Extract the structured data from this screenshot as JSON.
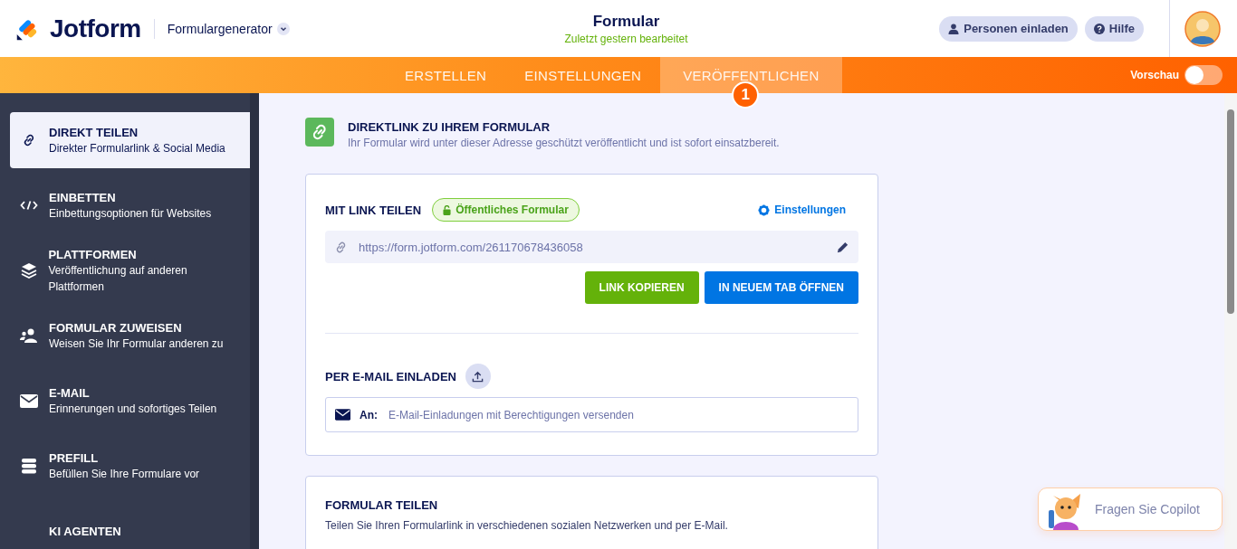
{
  "header": {
    "logo": "Jotform",
    "app_menu": "Formulargenerator",
    "title": "Formular",
    "subtitle": "Zuletzt gestern bearbeitet",
    "buttons": [
      "Personen einladen",
      "Hilfe"
    ]
  },
  "nav": {
    "tabs": [
      {
        "label": "ERSTELLEN",
        "selected": false
      },
      {
        "label": "EINSTELLUNGEN",
        "selected": false
      },
      {
        "label": "VERÖFFENTLICHEN",
        "selected": true,
        "badge": "1"
      }
    ],
    "preview": {
      "label": "Vorschau",
      "on": false
    }
  },
  "sidebar": {
    "items": [
      {
        "title": "DIREKT TEILEN",
        "description": "Direkter Formularlink & Social Media",
        "selected": true
      },
      {
        "title": "EINBETTEN",
        "description": "Einbettungsoptionen für Websites",
        "selected": false
      },
      {
        "title": "PLATTFORMEN",
        "description": "Veröffentlichung auf anderen Plattformen",
        "selected": false
      },
      {
        "title": "FORMULAR ZUWEISEN",
        "description": "Weisen Sie Ihr Formular anderen zu",
        "selected": false
      },
      {
        "title": "E-MAIL",
        "description": "Erinnerungen und sofortiges Teilen",
        "selected": false
      },
      {
        "title": "PREFILL",
        "description": "Befüllen Sie Ihre Formulare vor",
        "selected": false
      },
      {
        "title": "KI AGENTEN",
        "selected": false
      }
    ]
  },
  "main": {
    "intro": {
      "title": "DIREKTLINK ZU IHREM FORMULAR",
      "description": "Ihr Formular wird unter dieser Adresse geschützt veröffentlicht und ist sofort einsatzbereit."
    },
    "link_card": {
      "title": "MIT LINK TEILEN",
      "status_badge": "Öffentliches Formular",
      "settings_link": "Einstellungen",
      "url": "https://form.jotform.com/261170678436058",
      "buttons": [
        "LINK KOPIEREN",
        "IN NEUEM TAB ÖFFNEN"
      ],
      "email_title": "PER E-MAIL EINLADEN",
      "email_label": "An:",
      "email_placeholder": "E-Mail-Einladungen mit Berechtigungen versenden"
    },
    "share_card": {
      "title": "FORMULAR TEILEN",
      "description": "Teilen Sie Ihren Formularlink in verschiedenen sozialen Netzwerken und per E-Mail."
    }
  },
  "copilot": {
    "label": "Fragen Sie Copilot"
  }
}
